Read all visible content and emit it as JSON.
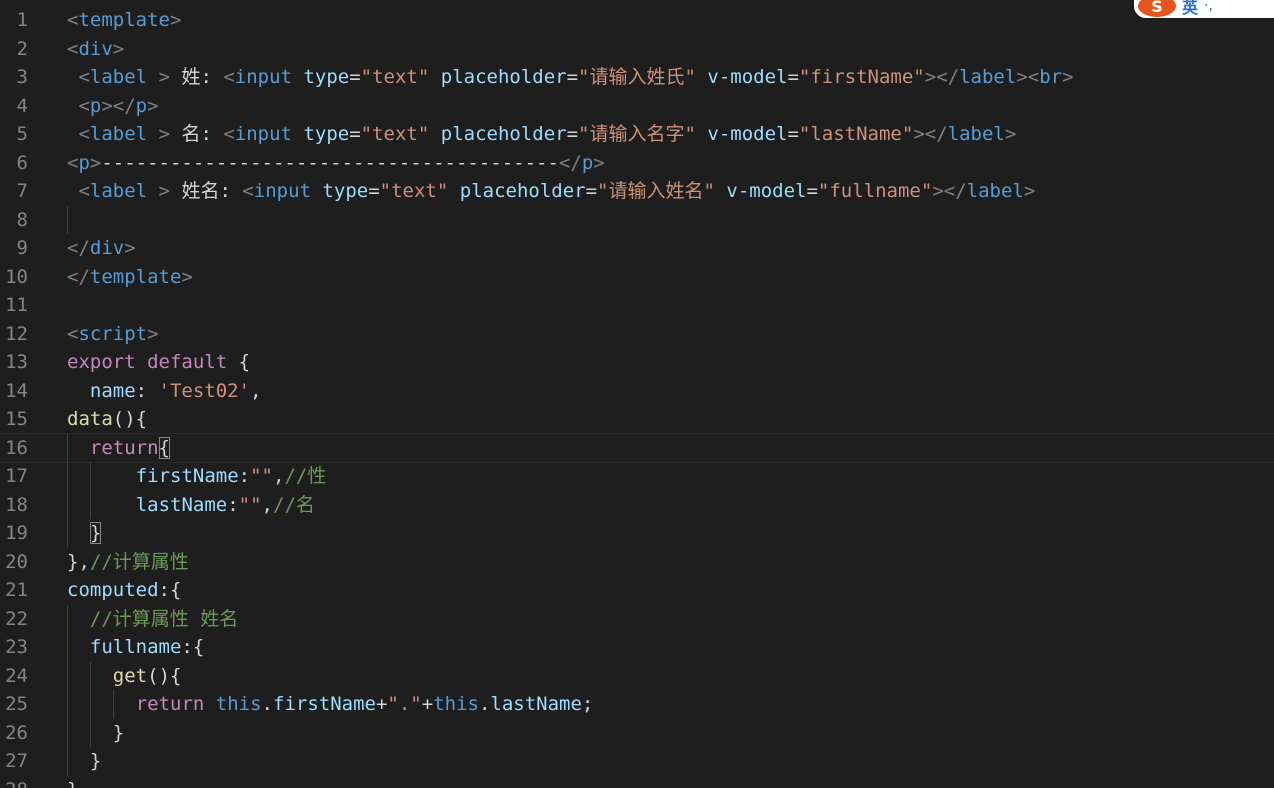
{
  "ime": {
    "logo": "S",
    "mode": "英",
    "punct": "·,"
  },
  "editor": {
    "current_line": 16,
    "match_brackets": [
      [
        16,
        1
      ],
      [
        19,
        0
      ]
    ],
    "lines": [
      {
        "n": "1",
        "indent": 0,
        "guides": [],
        "tokens": [
          [
            "br",
            "<"
          ],
          [
            "tag",
            "template"
          ],
          [
            "br",
            ">"
          ]
        ]
      },
      {
        "n": "2",
        "indent": 0,
        "guides": [],
        "tokens": [
          [
            "br",
            "<"
          ],
          [
            "tag",
            "div"
          ],
          [
            "br",
            ">"
          ]
        ]
      },
      {
        "n": "3",
        "indent": 1,
        "guides": [],
        "tokens": [
          [
            "br",
            "<"
          ],
          [
            "tag",
            "label"
          ],
          [
            "text",
            " "
          ],
          [
            "br",
            ">"
          ],
          [
            "text",
            " 姓: "
          ],
          [
            "br",
            "<"
          ],
          [
            "tag",
            "input"
          ],
          [
            "text",
            " "
          ],
          [
            "attr",
            "type"
          ],
          [
            "pun",
            "="
          ],
          [
            "str",
            "\"text\""
          ],
          [
            "text",
            " "
          ],
          [
            "attr",
            "placeholder"
          ],
          [
            "pun",
            "="
          ],
          [
            "str",
            "\"请输入姓氏\""
          ],
          [
            "text",
            " "
          ],
          [
            "attr",
            "v-model"
          ],
          [
            "pun",
            "="
          ],
          [
            "str",
            "\"firstName\""
          ],
          [
            "br",
            ">"
          ],
          [
            "br",
            "</"
          ],
          [
            "tag",
            "label"
          ],
          [
            "br",
            ">"
          ],
          [
            "br",
            "<"
          ],
          [
            "tag",
            "br"
          ],
          [
            "br",
            ">"
          ]
        ]
      },
      {
        "n": "4",
        "indent": 1,
        "guides": [],
        "tokens": [
          [
            "br",
            "<"
          ],
          [
            "tag",
            "p"
          ],
          [
            "br",
            "></"
          ],
          [
            "tag",
            "p"
          ],
          [
            "br",
            ">"
          ]
        ]
      },
      {
        "n": "5",
        "indent": 1,
        "guides": [],
        "tokens": [
          [
            "br",
            "<"
          ],
          [
            "tag",
            "label"
          ],
          [
            "text",
            " "
          ],
          [
            "br",
            ">"
          ],
          [
            "text",
            " 名: "
          ],
          [
            "br",
            "<"
          ],
          [
            "tag",
            "input"
          ],
          [
            "text",
            " "
          ],
          [
            "attr",
            "type"
          ],
          [
            "pun",
            "="
          ],
          [
            "str",
            "\"text\""
          ],
          [
            "text",
            " "
          ],
          [
            "attr",
            "placeholder"
          ],
          [
            "pun",
            "="
          ],
          [
            "str",
            "\"请输入名字\""
          ],
          [
            "text",
            " "
          ],
          [
            "attr",
            "v-model"
          ],
          [
            "pun",
            "="
          ],
          [
            "str",
            "\"lastName\""
          ],
          [
            "br",
            ">"
          ],
          [
            "br",
            "</"
          ],
          [
            "tag",
            "label"
          ],
          [
            "br",
            ">"
          ]
        ]
      },
      {
        "n": "6",
        "indent": 0,
        "guides": [],
        "tokens": [
          [
            "br",
            "<"
          ],
          [
            "tag",
            "p"
          ],
          [
            "br",
            ">"
          ],
          [
            "text",
            "----------------------------------------"
          ],
          [
            "br",
            "</"
          ],
          [
            "tag",
            "p"
          ],
          [
            "br",
            ">"
          ]
        ]
      },
      {
        "n": "7",
        "indent": 1,
        "guides": [],
        "tokens": [
          [
            "br",
            "<"
          ],
          [
            "tag",
            "label"
          ],
          [
            "text",
            " "
          ],
          [
            "br",
            ">"
          ],
          [
            "text",
            " 姓名: "
          ],
          [
            "br",
            "<"
          ],
          [
            "tag",
            "input"
          ],
          [
            "text",
            " "
          ],
          [
            "attr",
            "type"
          ],
          [
            "pun",
            "="
          ],
          [
            "str",
            "\"text\""
          ],
          [
            "text",
            " "
          ],
          [
            "attr",
            "placeholder"
          ],
          [
            "pun",
            "="
          ],
          [
            "str",
            "\"请输入姓名\""
          ],
          [
            "text",
            " "
          ],
          [
            "attr",
            "v-model"
          ],
          [
            "pun",
            "="
          ],
          [
            "str",
            "\"fullname\""
          ],
          [
            "br",
            ">"
          ],
          [
            "br",
            "</"
          ],
          [
            "tag",
            "label"
          ],
          [
            "br",
            ">"
          ]
        ]
      },
      {
        "n": "8",
        "indent": 0,
        "guides": [
          0
        ],
        "tokens": []
      },
      {
        "n": "9",
        "indent": 0,
        "guides": [],
        "tokens": [
          [
            "br",
            "</"
          ],
          [
            "tag",
            "div"
          ],
          [
            "br",
            ">"
          ]
        ]
      },
      {
        "n": "10",
        "indent": 0,
        "guides": [],
        "tokens": [
          [
            "br",
            "</"
          ],
          [
            "tag",
            "template"
          ],
          [
            "br",
            ">"
          ]
        ]
      },
      {
        "n": "11",
        "indent": 0,
        "guides": [],
        "tokens": []
      },
      {
        "n": "12",
        "indent": 0,
        "guides": [],
        "tokens": [
          [
            "br",
            "<"
          ],
          [
            "tag",
            "script"
          ],
          [
            "br",
            ">"
          ]
        ]
      },
      {
        "n": "13",
        "indent": 0,
        "guides": [],
        "tokens": [
          [
            "kw",
            "export"
          ],
          [
            "text",
            " "
          ],
          [
            "kw",
            "default"
          ],
          [
            "text",
            " "
          ],
          [
            "pun",
            "{"
          ]
        ]
      },
      {
        "n": "14",
        "indent": 2,
        "guides": [],
        "tokens": [
          [
            "prop",
            "name"
          ],
          [
            "pun",
            ": "
          ],
          [
            "str",
            "'Test02'"
          ],
          [
            "pun",
            ","
          ]
        ]
      },
      {
        "n": "15",
        "indent": 0,
        "guides": [],
        "tokens": [
          [
            "fn",
            "data"
          ],
          [
            "pun",
            "(){"
          ]
        ]
      },
      {
        "n": "16",
        "indent": 2,
        "guides": [
          0
        ],
        "tokens": [
          [
            "kw",
            "return"
          ],
          [
            "pun",
            "{"
          ]
        ]
      },
      {
        "n": "17",
        "indent": 6,
        "guides": [
          0,
          2
        ],
        "tokens": [
          [
            "prop",
            "firstName"
          ],
          [
            "pun",
            ":"
          ],
          [
            "str",
            "\"\""
          ],
          [
            "pun",
            ","
          ],
          [
            "com",
            "//性"
          ]
        ]
      },
      {
        "n": "18",
        "indent": 6,
        "guides": [
          0,
          2
        ],
        "tokens": [
          [
            "prop",
            "lastName"
          ],
          [
            "pun",
            ":"
          ],
          [
            "str",
            "\"\""
          ],
          [
            "pun",
            ","
          ],
          [
            "com",
            "//名"
          ]
        ]
      },
      {
        "n": "19",
        "indent": 2,
        "guides": [
          0
        ],
        "tokens": [
          [
            "pun",
            "}"
          ]
        ]
      },
      {
        "n": "20",
        "indent": 0,
        "guides": [],
        "tokens": [
          [
            "pun",
            "},"
          ],
          [
            "com",
            "//计算属性"
          ]
        ]
      },
      {
        "n": "21",
        "indent": 0,
        "guides": [],
        "tokens": [
          [
            "prop",
            "computed"
          ],
          [
            "pun",
            ":{"
          ]
        ]
      },
      {
        "n": "22",
        "indent": 2,
        "guides": [
          0
        ],
        "tokens": [
          [
            "com",
            "//计算属性 姓名"
          ]
        ]
      },
      {
        "n": "23",
        "indent": 2,
        "guides": [
          0
        ],
        "tokens": [
          [
            "prop",
            "fullname"
          ],
          [
            "pun",
            ":{"
          ]
        ]
      },
      {
        "n": "24",
        "indent": 4,
        "guides": [
          0,
          2
        ],
        "tokens": [
          [
            "fn",
            "get"
          ],
          [
            "pun",
            "(){"
          ]
        ]
      },
      {
        "n": "25",
        "indent": 6,
        "guides": [
          0,
          2,
          4
        ],
        "tokens": [
          [
            "kw",
            "return"
          ],
          [
            "text",
            " "
          ],
          [
            "blue",
            "this"
          ],
          [
            "pun",
            "."
          ],
          [
            "prop",
            "firstName"
          ],
          [
            "pun",
            "+"
          ],
          [
            "str",
            "\".\""
          ],
          [
            "pun",
            "+"
          ],
          [
            "blue",
            "this"
          ],
          [
            "pun",
            "."
          ],
          [
            "prop",
            "lastName"
          ],
          [
            "pun",
            ";"
          ]
        ]
      },
      {
        "n": "26",
        "indent": 4,
        "guides": [
          0,
          2
        ],
        "tokens": [
          [
            "pun",
            "}"
          ]
        ]
      },
      {
        "n": "27",
        "indent": 2,
        "guides": [
          0
        ],
        "tokens": [
          [
            "pun",
            "}"
          ]
        ]
      },
      {
        "n": "28",
        "indent": 0,
        "guides": [],
        "tokens": [
          [
            "pun",
            "},"
          ]
        ]
      }
    ]
  }
}
